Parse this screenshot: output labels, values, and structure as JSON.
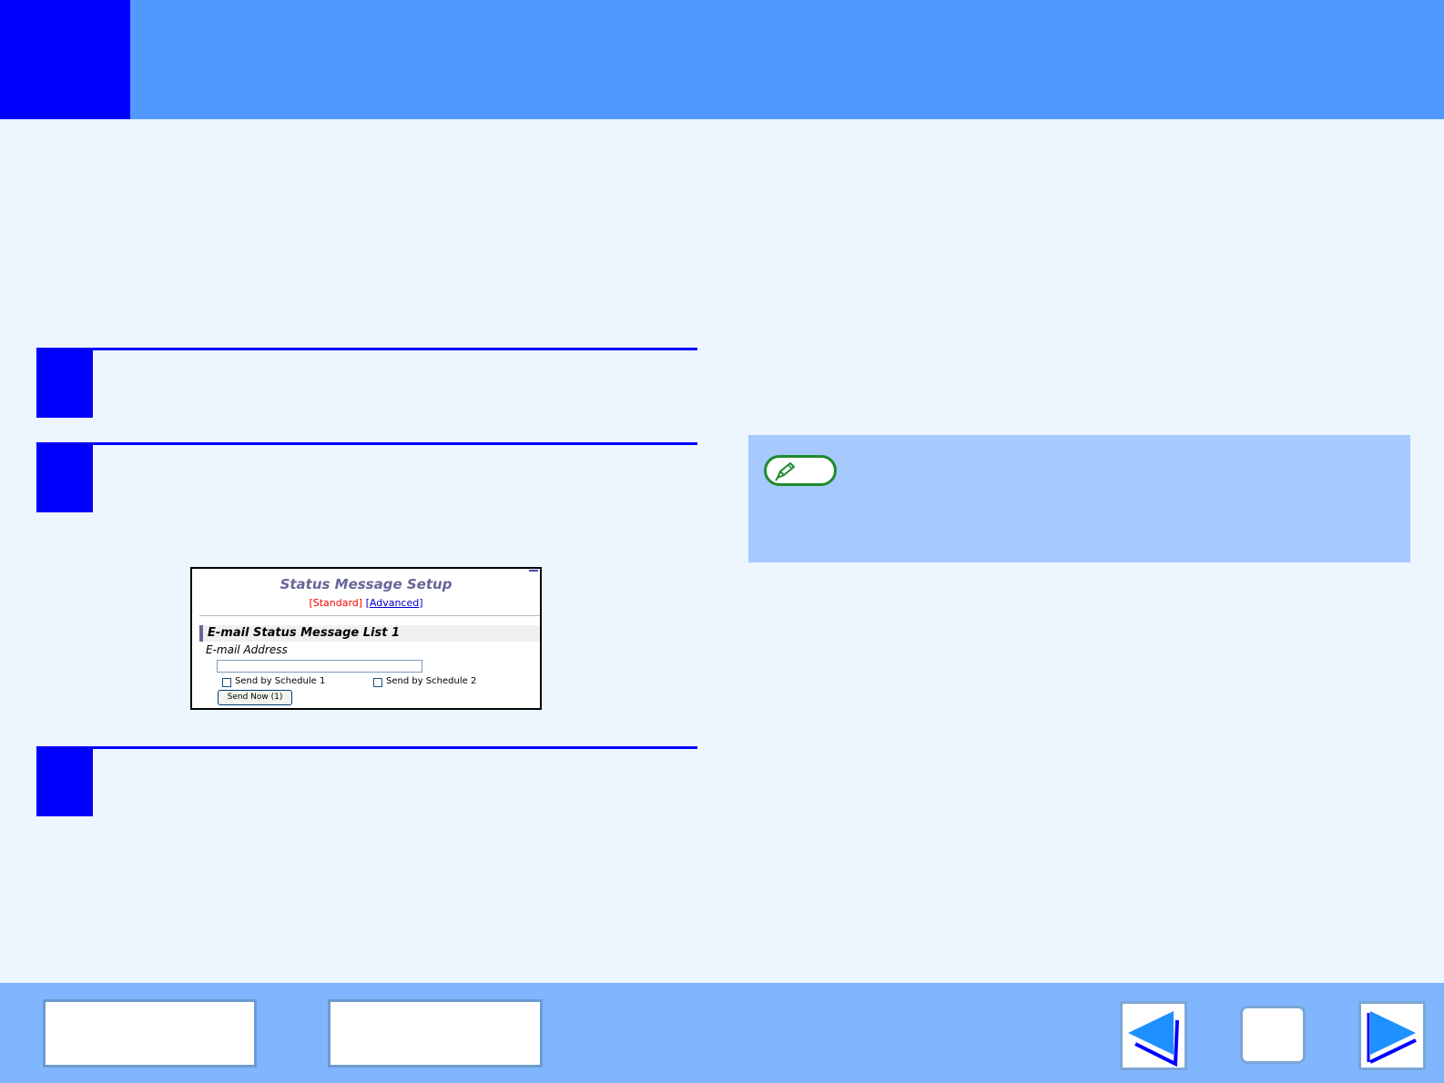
{
  "dialog": {
    "title": "Status Message Setup",
    "mode_standard": "[Standard]",
    "mode_space": " ",
    "mode_advanced_open": "[",
    "mode_advanced": "Advanced",
    "mode_advanced_close": "]",
    "section_title": "E-mail Status Message List 1",
    "email_label": "E-mail Address",
    "email_value": "",
    "schedule1_label": "Send by Schedule 1",
    "schedule2_label": "Send by Schedule 2",
    "send_now_label": "Send Now (1)"
  },
  "colors": {
    "header": "#5299ff",
    "accent": "#0000ff",
    "background": "#edf5fe",
    "note_box": "#a6c9fe",
    "footer": "#80b6fd",
    "nav_arrow": "#1e90ff"
  },
  "icons": {
    "note": "pencil-icon",
    "previous": "arrow-left-icon",
    "next": "arrow-right-icon",
    "home": "home-icon"
  }
}
